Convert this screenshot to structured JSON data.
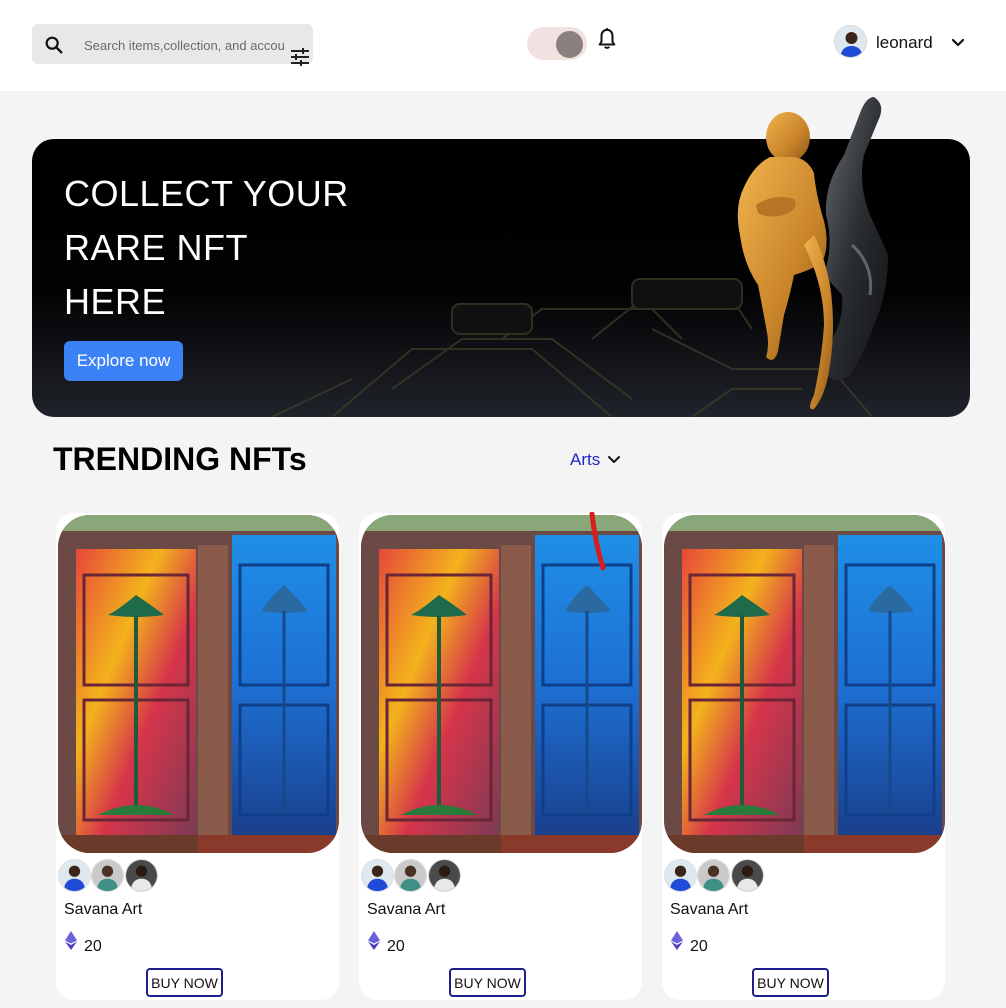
{
  "header": {
    "search": {
      "placeholder": "Search items,collection, and accounts"
    },
    "user": {
      "name": "leonard"
    }
  },
  "hero": {
    "title_lines": [
      "COLLECT YOUR",
      "RARE NFT",
      "HERE"
    ],
    "cta_label": "Explore now"
  },
  "trending": {
    "title": "TRENDING NFTs",
    "category": "Arts",
    "cards": [
      {
        "name": "Savana Art",
        "price": "20",
        "buy_label": "BUY NOW"
      },
      {
        "name": "Savana Art",
        "price": "20",
        "buy_label": "BUY NOW"
      },
      {
        "name": "Savana Art",
        "price": "20",
        "buy_label": "BUY NOW"
      }
    ]
  },
  "colors": {
    "accent": "#3b82f6",
    "category_link": "#1d28c8",
    "buy_border": "#1e1e8e"
  }
}
